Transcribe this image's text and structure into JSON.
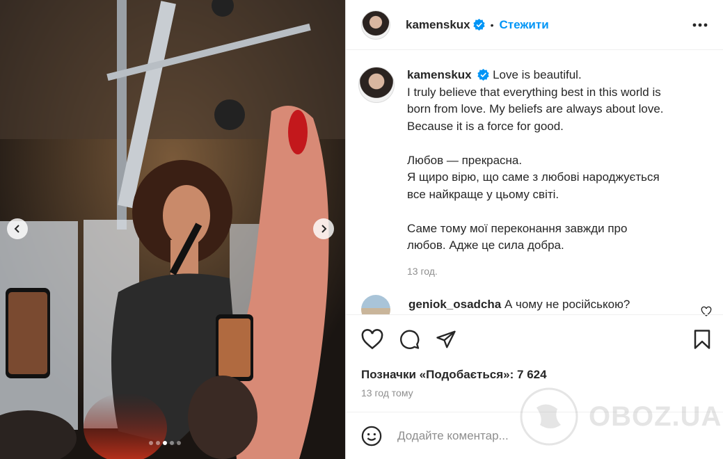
{
  "post": {
    "username": "kamenskux",
    "follow_label": "Стежити",
    "separator": "•",
    "caption": {
      "first_line": "Love is beautiful.",
      "lines_en": [
        "I truly believe that everything best in this world is",
        "born from love. My beliefs are always about love.",
        "Because it is a force for good."
      ],
      "lines_ua_1": [
        "Любов — прекрасна.",
        "Я щиро вірю, що саме з любові народжується",
        "все найкраще у цьому світі."
      ],
      "lines_ua_2": [
        "Саме тому мої переконання завжди про",
        "любов. Адже це сила добра."
      ],
      "time": "13 год."
    },
    "comment": {
      "username": "geniok_osadcha",
      "text": "А чому не російською?"
    },
    "likes_label": "Позначки «Подобається»: 7 624",
    "posted_ago": "13 год тому",
    "add_comment_placeholder": "Додайте коментар..."
  },
  "carousel": {
    "slide_count": 5,
    "active_index": 2
  },
  "watermark": {
    "text": "OBOZ.UA"
  },
  "icons": {
    "verified": "verified-badge-icon",
    "more": "more-options-icon",
    "like": "heart-icon",
    "comment": "comment-icon",
    "share": "share-icon",
    "save": "bookmark-icon",
    "emoji": "emoji-icon",
    "prev": "chevron-left-icon",
    "next": "chevron-right-icon"
  },
  "colors": {
    "accent": "#0095f6",
    "verified": "#0095f6",
    "text": "#262626",
    "muted": "#8e8e8e"
  }
}
